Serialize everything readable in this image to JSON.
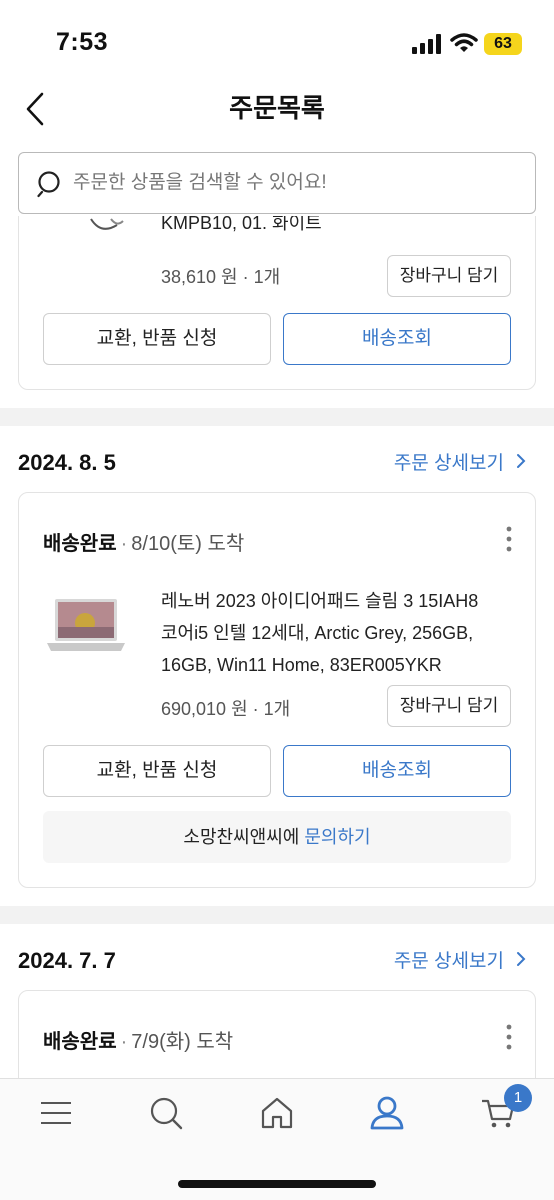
{
  "status_bar": {
    "time": "7:53",
    "battery": "63"
  },
  "header": {
    "title": "주문목록"
  },
  "search": {
    "placeholder": "주문한 상품을 검색할 수 있어요!"
  },
  "orders": [
    {
      "product_partial": "KMPB10, 01. 화이트",
      "price": "38,610 원",
      "qty": "1개",
      "cart_label": "장바구니 담기",
      "exchange_label": "교환, 반품 신청",
      "track_label": "배송조회"
    },
    {
      "date": "2024. 8. 5",
      "detail_label": "주문 상세보기",
      "status": "배송완료",
      "eta": "8/10(토) 도착",
      "product_lines": [
        "레노버 2023 아이디어패드 슬림 3 15IAH8",
        "코어i5 인텔 12세대, Arctic Grey, 256GB,",
        "16GB, Win11 Home, 83ER005YKR"
      ],
      "price": "690,010 원",
      "qty": "1개",
      "cart_label": "장바구니 담기",
      "exchange_label": "교환, 반품 신청",
      "track_label": "배송조회",
      "seller_prefix": "소망찬씨앤씨에",
      "inquiry_label": "문의하기"
    },
    {
      "date": "2024. 7. 7",
      "detail_label": "주문 상세보기",
      "status": "배송완료",
      "eta": "7/9(화) 도착"
    }
  ],
  "tab_bar": {
    "items": [
      {
        "icon": "menu-icon"
      },
      {
        "icon": "search-icon"
      },
      {
        "icon": "home-icon"
      },
      {
        "icon": "user-icon",
        "active": true
      },
      {
        "icon": "cart-icon"
      }
    ],
    "cart_badge": "1"
  },
  "colors": {
    "accent": "#3a78c9",
    "battery": "#f5d51c"
  }
}
